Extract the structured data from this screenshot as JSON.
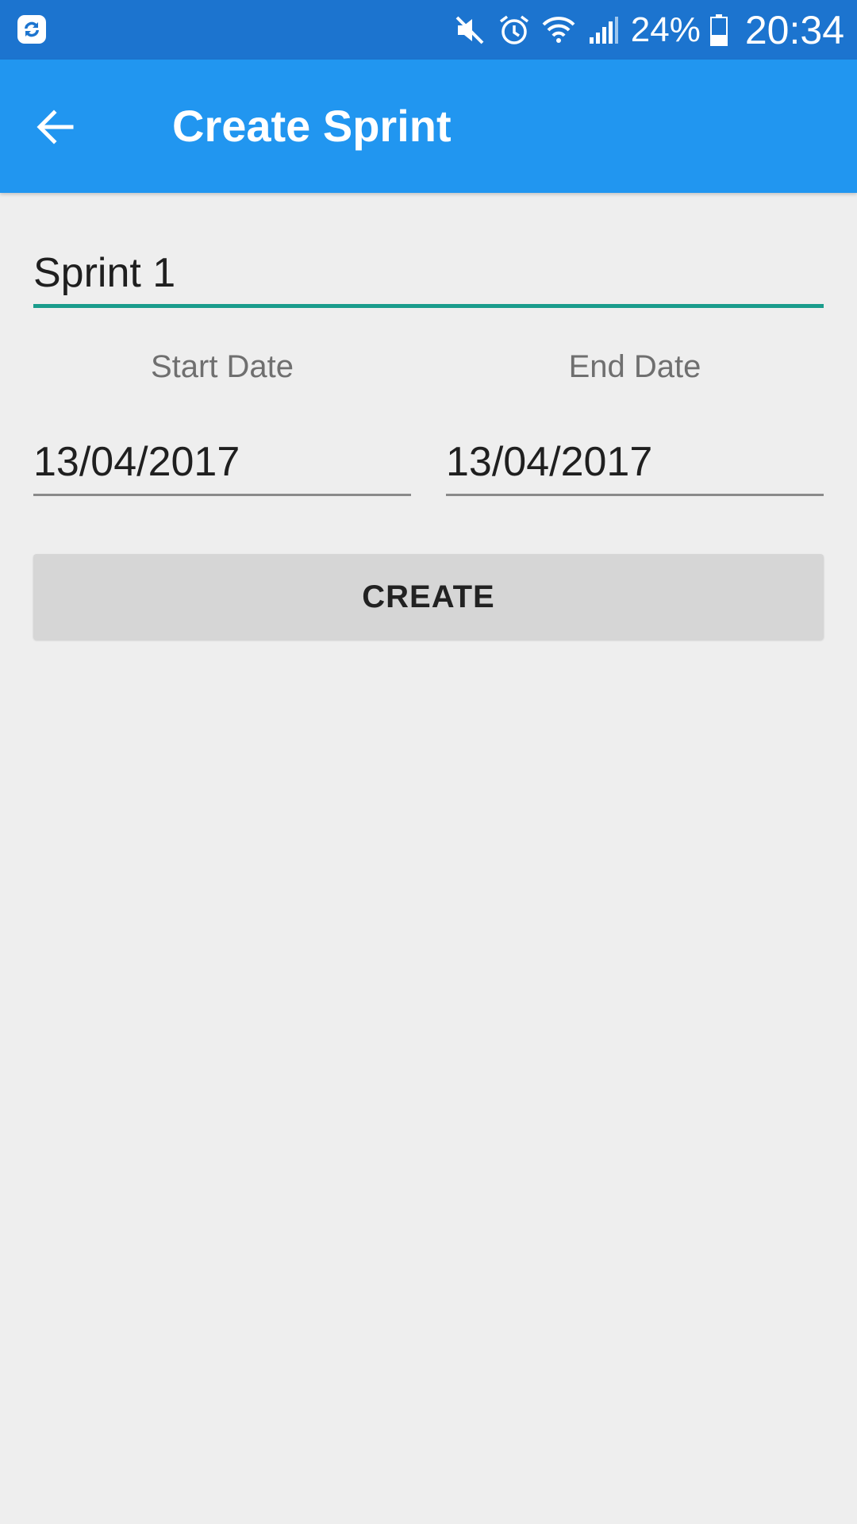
{
  "status_bar": {
    "battery_percent": "24%",
    "time": "20:34",
    "icons": [
      "sync-icon",
      "mute-icon",
      "alarm-icon",
      "wifi-icon",
      "signal-icon",
      "battery-icon"
    ],
    "background": "#1c74cf"
  },
  "app_bar": {
    "title": "Create Sprint",
    "background": "#2196f0"
  },
  "form": {
    "sprint_name": "Sprint 1",
    "start_date_label": "Start Date",
    "end_date_label": "End Date",
    "start_date": "13/04/2017",
    "end_date": "13/04/2017",
    "create_label": "CREATE",
    "focus_underline_color": "#1a9c8c"
  }
}
